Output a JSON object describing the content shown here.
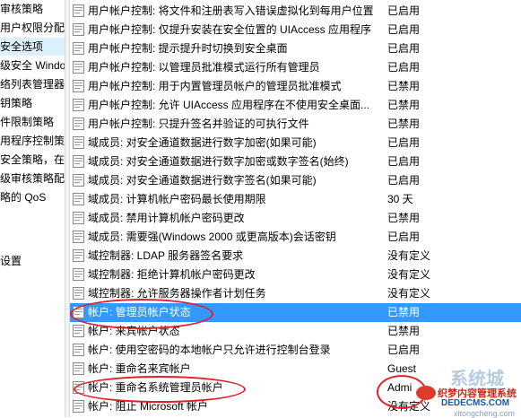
{
  "tree": [
    {
      "label": "审核策略",
      "selected": false
    },
    {
      "label": "用户权限分配",
      "selected": false
    },
    {
      "label": "安全选项",
      "selected": true
    },
    {
      "label": "级安全 Windo",
      "selected": false
    },
    {
      "label": "络列表管理器策",
      "selected": false
    },
    {
      "label": "钥策略",
      "selected": false
    },
    {
      "label": "件限制策略",
      "selected": false
    },
    {
      "label": "用程序控制策略",
      "selected": false
    },
    {
      "label": "安全策略，在",
      "selected": false
    },
    {
      "label": "级审核策略配",
      "selected": false
    },
    {
      "label": "略的 QoS",
      "selected": false
    },
    {
      "label": "设置",
      "selected": false
    }
  ],
  "policies": [
    {
      "name": "用户帐户控制: 将文件和注册表写入错误虚拟化到每用户位置",
      "value": "已启用",
      "selected": false
    },
    {
      "name": "用户帐户控制: 仅提升安装在安全位置的 UIAccess 应用程序",
      "value": "已启用",
      "selected": false
    },
    {
      "name": "用户帐户控制: 提示提升时切换到安全桌面",
      "value": "已启用",
      "selected": false
    },
    {
      "name": "用户帐户控制: 以管理员批准模式运行所有管理员",
      "value": "已启用",
      "selected": false
    },
    {
      "name": "用户帐户控制: 用于内置管理员帐户的管理员批准模式",
      "value": "已禁用",
      "selected": false
    },
    {
      "name": "用户帐户控制: 允许 UIAccess 应用程序在不使用安全桌面...",
      "value": "已禁用",
      "selected": false
    },
    {
      "name": "用户帐户控制: 只提升签名并验证的可执行文件",
      "value": "已禁用",
      "selected": false
    },
    {
      "name": "域成员: 对安全通道数据进行数字加密(如果可能)",
      "value": "已启用",
      "selected": false
    },
    {
      "name": "域成员: 对安全通道数据进行数字加密或数字签名(始终)",
      "value": "已启用",
      "selected": false
    },
    {
      "name": "域成员: 对安全通道数据进行数字签名(如果可能)",
      "value": "已启用",
      "selected": false
    },
    {
      "name": "域成员: 计算机帐户密码最长使用期限",
      "value": "30 天",
      "selected": false
    },
    {
      "name": "域成员: 禁用计算机帐户密码更改",
      "value": "已禁用",
      "selected": false
    },
    {
      "name": "域成员: 需要强(Windows 2000 或更高版本)会话密钥",
      "value": "已启用",
      "selected": false
    },
    {
      "name": "域控制器: LDAP 服务器签名要求",
      "value": "没有定义",
      "selected": false
    },
    {
      "name": "域控制器: 拒绝计算机帐户密码更改",
      "value": "没有定义",
      "selected": false
    },
    {
      "name": "域控制器: 允许服务器操作者计划任务",
      "value": "没有定义",
      "selected": false
    },
    {
      "name": "帐户: 管理员帐户状态",
      "value": "已禁用",
      "selected": true
    },
    {
      "name": "帐户: 来宾帐户状态",
      "value": "已禁用",
      "selected": false
    },
    {
      "name": "帐户: 使用空密码的本地帐户只允许进行控制台登录",
      "value": "已启用",
      "selected": false
    },
    {
      "name": "帐户: 重命名来宾帐户",
      "value": "Guest",
      "selected": false
    },
    {
      "name": "帐户: 重命名系统管理员帐户",
      "value": "Admi",
      "selected": false
    },
    {
      "name": "帐户: 阻止 Microsoft 帐户",
      "value": "没有定义",
      "selected": false
    }
  ],
  "watermark": {
    "line1": "系统城",
    "line2": "织梦内容管理系统",
    "line3": "DEDECMS.COM",
    "line4": "xitongcheng.com"
  },
  "colors": {
    "selection": "#3399ff",
    "annotation": "#e0202a",
    "tree_selected": "#dceffc"
  }
}
